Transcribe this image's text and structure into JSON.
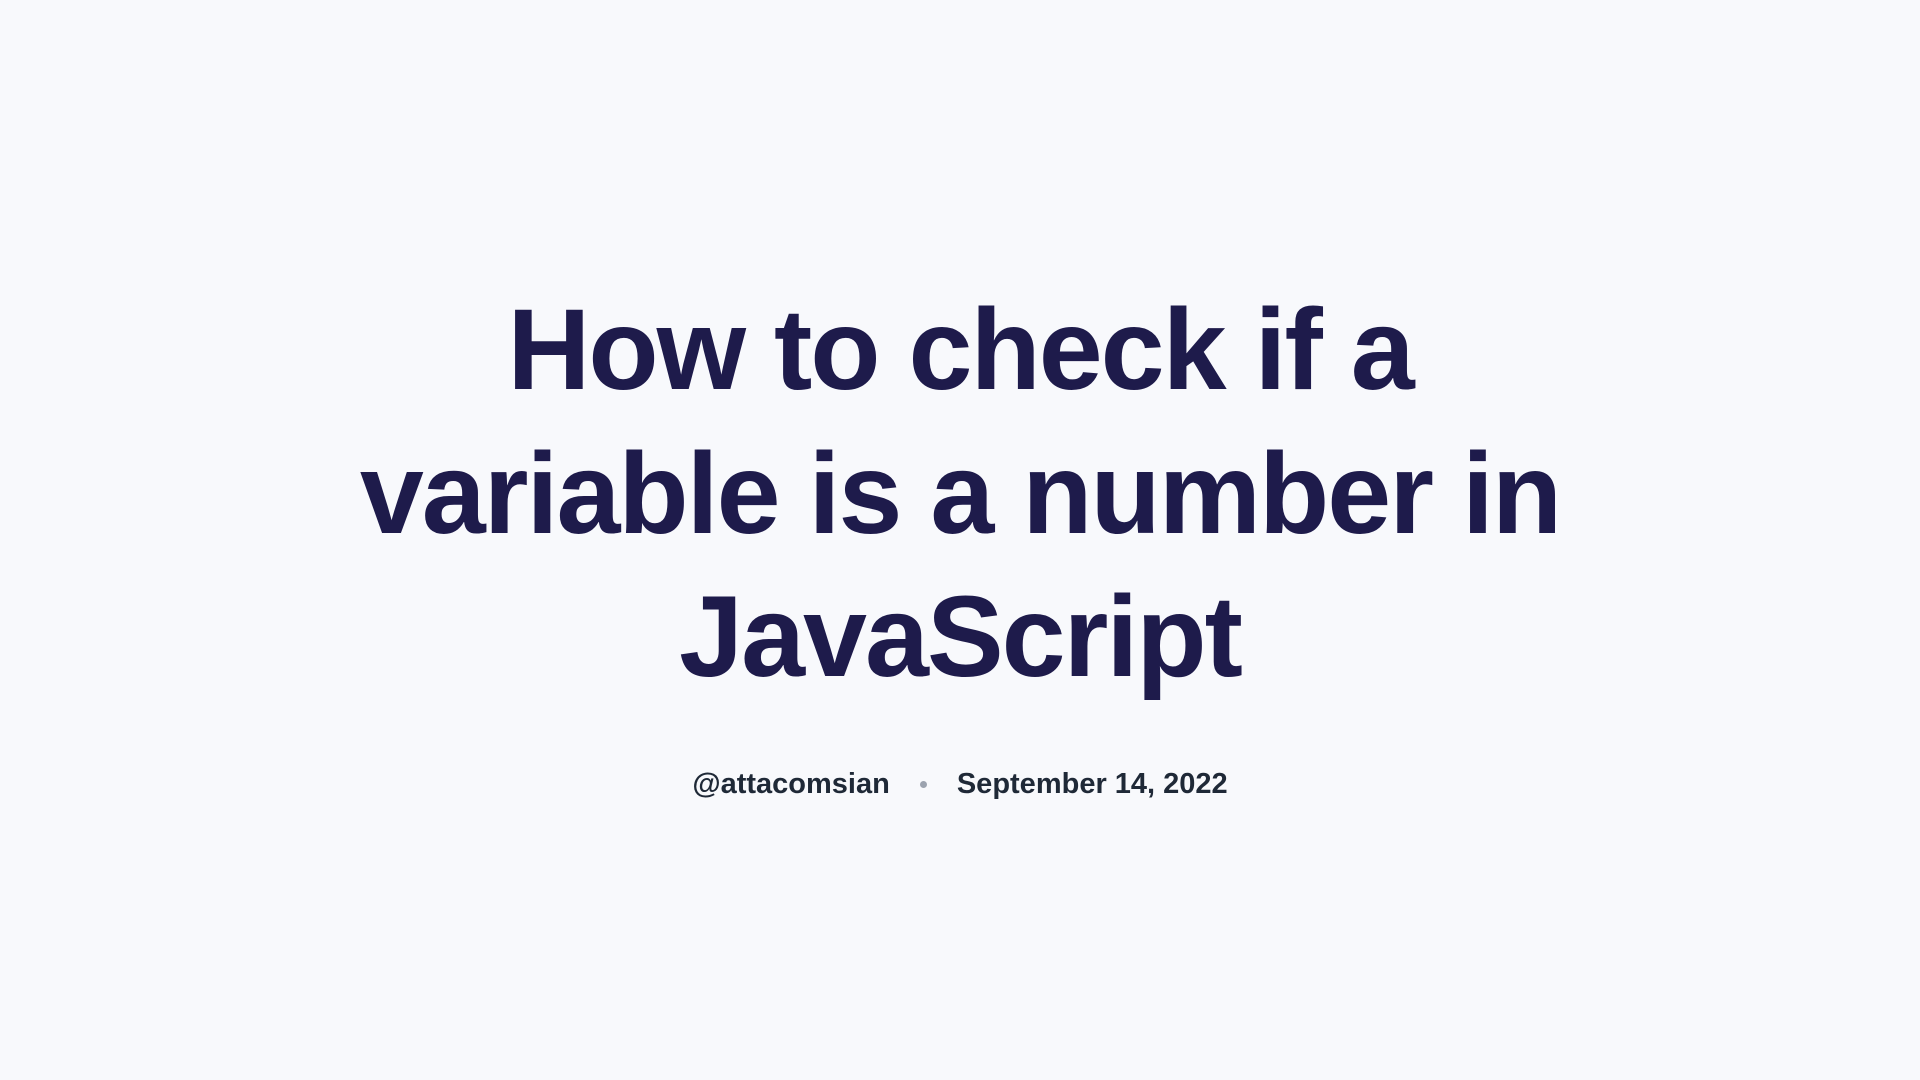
{
  "article": {
    "title": "How to check if a variable is a number in JavaScript",
    "author": "@attacomsian",
    "date": "September 14, 2022"
  }
}
